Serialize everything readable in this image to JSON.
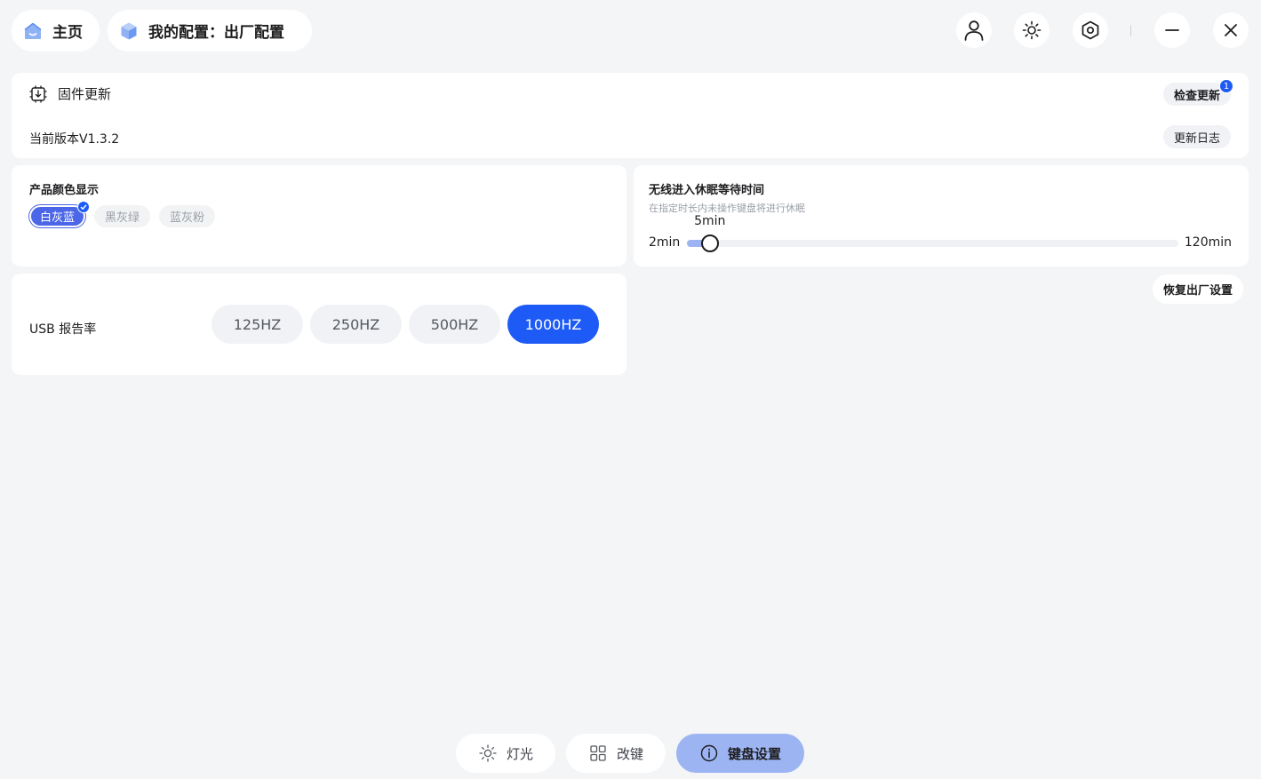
{
  "header": {
    "home_label": "主页",
    "config_label": "我的配置：出厂配置",
    "icons": [
      "user-icon",
      "brightness-icon",
      "settings-hex-icon",
      "minimize-icon",
      "close-icon"
    ]
  },
  "firmware": {
    "title": "固件更新",
    "version": "当前版本V1.3.2",
    "check_label": "检查更新",
    "check_badge": "1",
    "log_label": "更新日志"
  },
  "color_display": {
    "title": "产品颜色显示",
    "options": [
      "白灰蓝",
      "黑灰绿",
      "蓝灰粉"
    ],
    "selected": "白灰蓝"
  },
  "sleep": {
    "title": "无线进入休眠等待时间",
    "subtitle": "在指定时长内未操作键盘将进行休眠",
    "min_label": "2min",
    "max_label": "120min",
    "value_label": "5min",
    "min": 2,
    "max": 120,
    "value": 5
  },
  "reset_label": "恢复出厂设置",
  "usb": {
    "label": "USB 报告率",
    "options": [
      "125HZ",
      "250HZ",
      "500HZ",
      "1000HZ"
    ],
    "selected": "1000HZ"
  },
  "tabs": {
    "light": "灯光",
    "remap": "改键",
    "settings": "键盘设置",
    "active": "settings"
  },
  "colors": {
    "accent": "#1e5bf6",
    "accent_soft": "#9db4f2",
    "selected_chip": "#4b66e6",
    "background": "#f4f5f7"
  }
}
